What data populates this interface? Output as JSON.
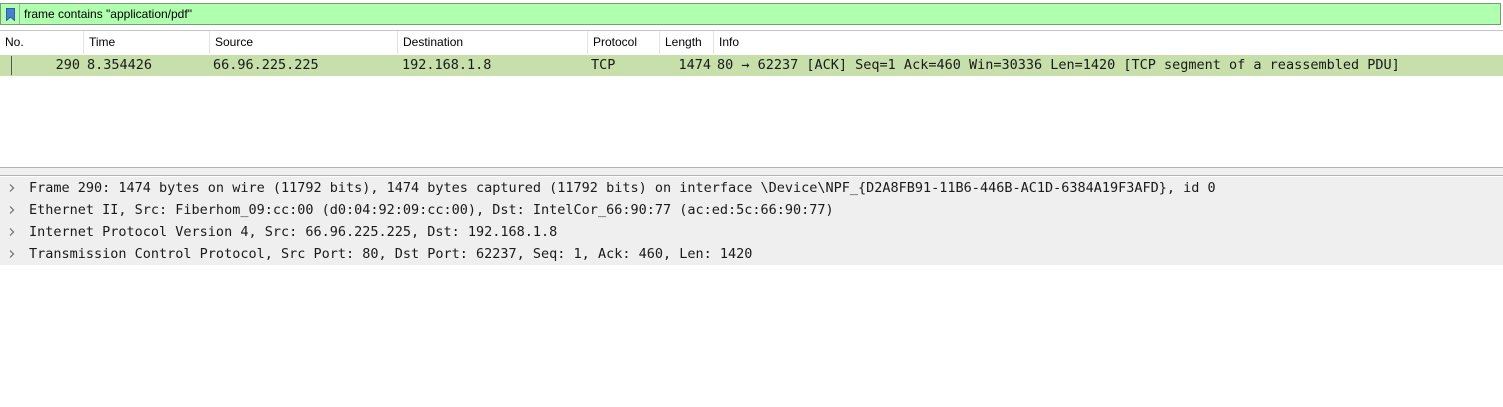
{
  "filter": {
    "value": "frame contains \"application/pdf\"",
    "accent_color": "#afffaf"
  },
  "columns": {
    "no": "No.",
    "time": "Time",
    "source": "Source",
    "destination": "Destination",
    "protocol": "Protocol",
    "length": "Length",
    "info": "Info"
  },
  "packets": [
    {
      "no": "290",
      "time": "8.354426",
      "source": "66.96.225.225",
      "destination": "192.168.1.8",
      "protocol": "TCP",
      "length": "1474",
      "info": "80 → 62237 [ACK] Seq=1 Ack=460 Win=30336 Len=1420 [TCP segment of a reassembled PDU]",
      "row_color": "#c7dfab"
    }
  ],
  "details": [
    {
      "text": "Frame 290: 1474 bytes on wire (11792 bits), 1474 bytes captured (11792 bits) on interface \\Device\\NPF_{D2A8FB91-11B6-446B-AC1D-6384A19F3AFD}, id 0",
      "icon": "chevron-right-icon"
    },
    {
      "text": "Ethernet II, Src: Fiberhom_09:cc:00 (d0:04:92:09:cc:00), Dst: IntelCor_66:90:77 (ac:ed:5c:66:90:77)",
      "icon": "chevron-right-icon"
    },
    {
      "text": "Internet Protocol Version 4, Src: 66.96.225.225, Dst: 192.168.1.8",
      "icon": "chevron-right-icon"
    },
    {
      "text": "Transmission Control Protocol, Src Port: 80, Dst Port: 62237, Seq: 1, Ack: 460, Len: 1420",
      "icon": "chevron-right-icon"
    }
  ]
}
